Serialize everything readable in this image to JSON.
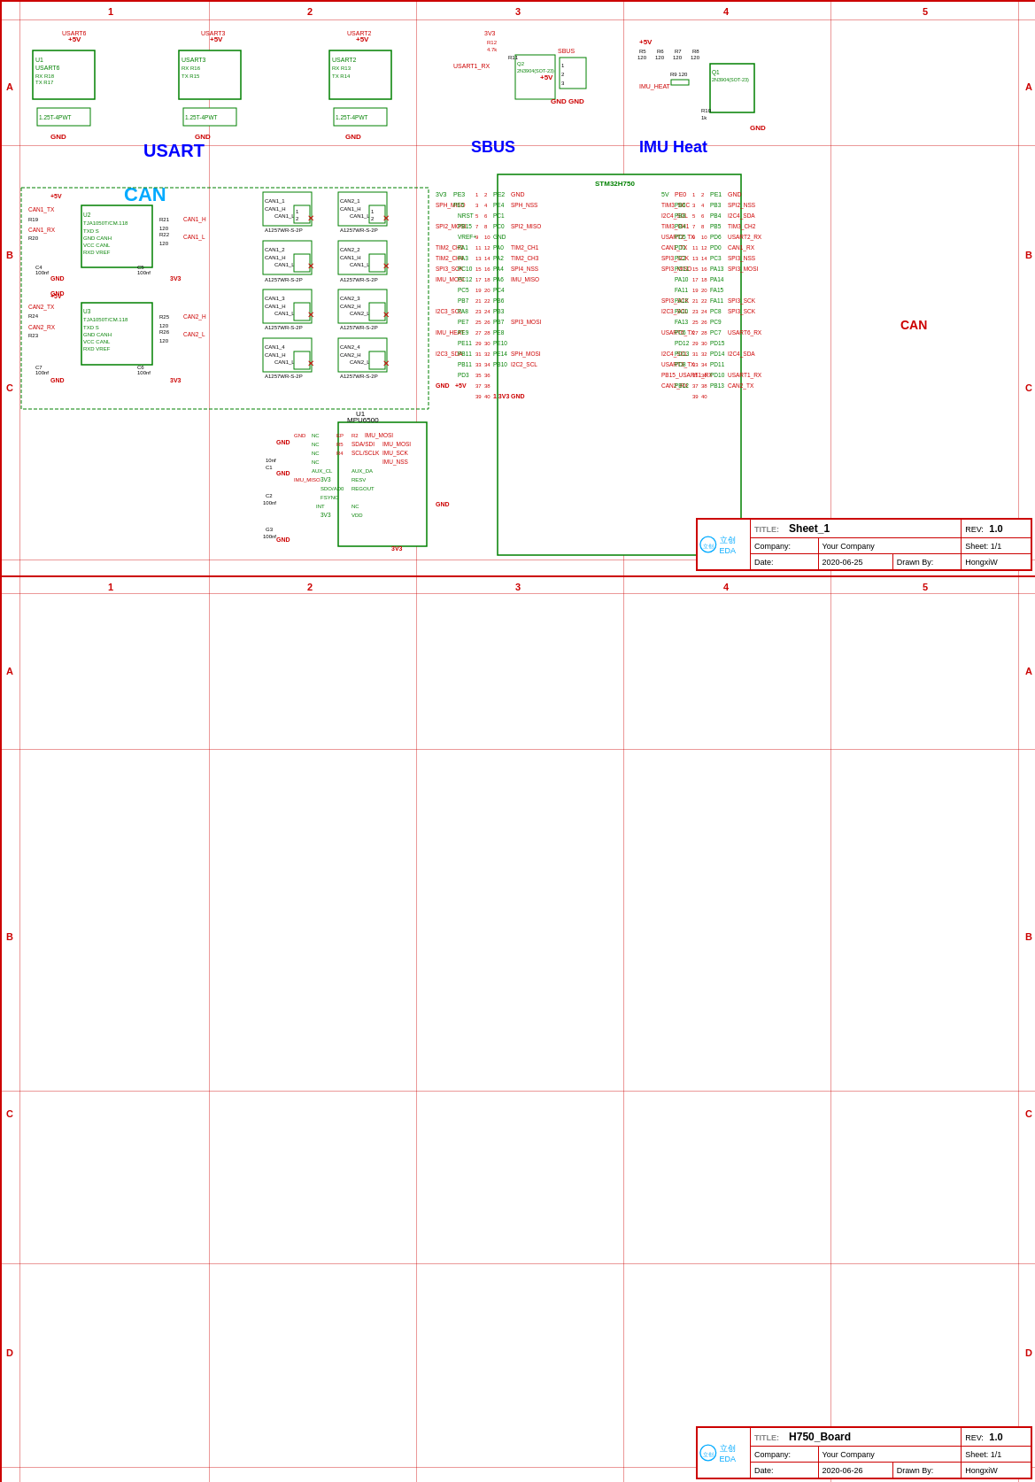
{
  "page1": {
    "title": "Sheet_1",
    "rev": "1.0",
    "company": "Your Company",
    "date": "2020-06-25",
    "drawn_by": "HongxiW",
    "sheet": "1/1",
    "sections": {
      "usart": "USART",
      "sbus": "SBUS",
      "imu_heat": "IMU Heat",
      "can": "CAN"
    }
  },
  "page2": {
    "title": "H750_Board",
    "rev": "1.0",
    "company": "Your Company",
    "date": "2020-06-26",
    "drawn_by": "HongxiW",
    "sheet": "1/1"
  },
  "rows": [
    "A",
    "B",
    "C",
    "D"
  ],
  "cols": [
    "1",
    "2",
    "3",
    "4",
    "5"
  ],
  "colors": {
    "red": "#c00",
    "green": "#008000",
    "blue": "#00f",
    "cyan": "#00aaff",
    "black": "#000"
  }
}
